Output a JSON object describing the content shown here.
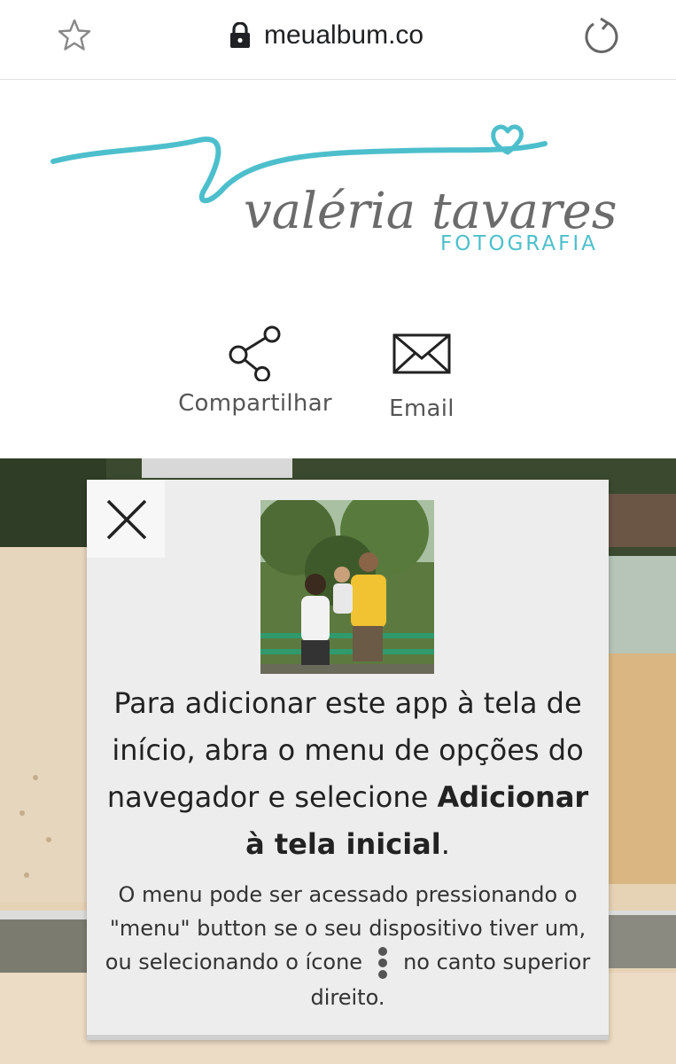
{
  "browser": {
    "url": "meualbum.co",
    "icons": [
      "star-icon",
      "lock-icon",
      "reload-icon"
    ]
  },
  "logo": {
    "name": "valéria tavares",
    "tagline": "FOTOGRAFIA",
    "brand_color": "#4dbfcc"
  },
  "share": {
    "compartilhar_label": "Compartilhar",
    "email_label": "Email"
  },
  "modal": {
    "text_before": "Para adicionar este app à tela de início, abra o menu de opções do navegador e selecione ",
    "text_bold": "Adicionar à tela inicial",
    "text_after": ".",
    "sub_before": "O menu pode ser acessado pressionando o \"menu\" button se o seu dispositivo tiver um, ou selecionando o ícone",
    "sub_after": "no canto superior direito.",
    "icons": [
      "close-icon",
      "more-vert-icon"
    ]
  }
}
